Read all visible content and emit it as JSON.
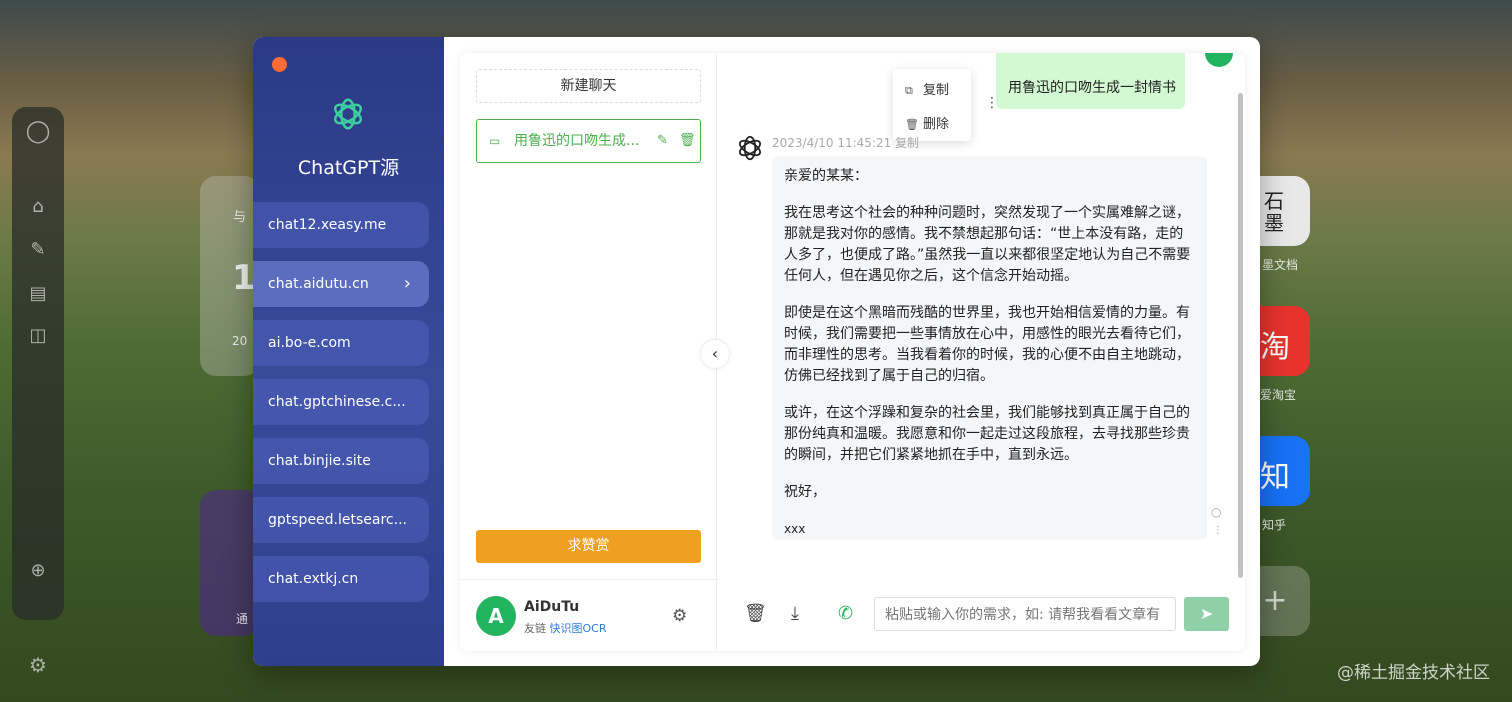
{
  "background": {
    "tile_texts": [
      "与",
      "1",
      "20",
      "石墨",
      "墨文档",
      "淘",
      "爱淘宝",
      "知",
      "知乎",
      "通"
    ],
    "watermark": "@稀土掘金技术社区"
  },
  "sidebar": {
    "brand": "ChatGPT源",
    "sites": [
      {
        "label": "chat12.xeasy.me"
      },
      {
        "label": "chat.aidutu.cn",
        "active": true
      },
      {
        "label": "ai.bo-e.com"
      },
      {
        "label": "chat.gptchinese.c..."
      },
      {
        "label": "chat.binjie.site"
      },
      {
        "label": "gptspeed.letsearc..."
      },
      {
        "label": "chat.extkj.cn"
      }
    ],
    "active_chevron": "›"
  },
  "sessions": {
    "new_chat_label": "新建聊天",
    "items": [
      {
        "title": "用鲁迅的口吻生成..."
      }
    ],
    "donate_label": "求赞赏"
  },
  "profile": {
    "name": "AiDuTu",
    "friend_prefix": "友链",
    "friend_link": "快识图OCR"
  },
  "chat": {
    "user_message": "用鲁迅的口吻生成一封情书",
    "context_menu": {
      "copy": "复制",
      "delete": "删除"
    },
    "meta": "2023/4/10 11:45:21 复制",
    "bot_paragraphs": [
      "亲爱的某某：",
      "我在思考这个社会的种种问题时，突然发现了一个实属难解之谜，那就是我对你的感情。我不禁想起那句话：“世上本没有路，走的人多了，也便成了路。”虽然我一直以来都很坚定地认为自己不需要任何人，但在遇见你之后，这个信念开始动摇。",
      "即使是在这个黑暗而残酷的世界里，我也开始相信爱情的力量。有时候，我们需要把一些事情放在心中，用感性的眼光去看待它们，而非理性的思考。当我看着你的时候，我的心便不由自主地跳动，仿佛已经找到了属于自己的归宿。",
      "或许，在这个浮躁和复杂的社会里，我们能够找到真正属于自己的那份纯真和温暖。我愿意和你一起走过这段旅程，去寻找那些珍贵的瞬间，并把它们紧紧地抓在手中，直到永远。",
      "祝好，",
      "xxx"
    ],
    "input_placeholder": "粘贴或输入你的需求，如: 请帮我看看文章有"
  },
  "colors": {
    "accent_green": "#4caf50",
    "donate_orange": "#f0a020",
    "sidebar_blue": "#2b3a86",
    "user_bubble": "#d2f9d1"
  }
}
